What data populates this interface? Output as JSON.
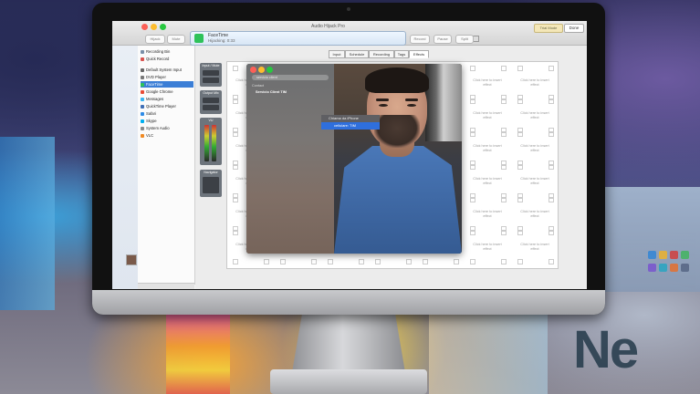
{
  "app": {
    "title": "Audio Hijack Pro",
    "trial_label": "Trial Mode",
    "done_label": "Done",
    "toolbar": {
      "left_btn": "Hijack",
      "left_btn2": "Mute",
      "right_btn": "Record",
      "right_btn2": "Pause",
      "right_btn3": "Split"
    }
  },
  "now_hijacking": {
    "app_name": "FaceTime",
    "status": "Hijacking: 0:33"
  },
  "sidebar": {
    "items": [
      {
        "label": "Recording Bin",
        "color": "#7a8fa8"
      },
      {
        "label": "Quick Record",
        "color": "#d9534f"
      },
      {
        "label": "Default System Input",
        "color": "#666666"
      },
      {
        "label": "DVD Player",
        "color": "#777777"
      },
      {
        "label": "FaceTime",
        "color": "#2ec25a"
      },
      {
        "label": "Google Chrome",
        "color": "#e94b35"
      },
      {
        "label": "Messages",
        "color": "#3ab4f2"
      },
      {
        "label": "QuickTime Player",
        "color": "#3f6fb6"
      },
      {
        "label": "Safari",
        "color": "#2f8be6"
      },
      {
        "label": "Skype",
        "color": "#00aff0"
      },
      {
        "label": "System Audio",
        "color": "#8a8a8a"
      },
      {
        "label": "VLC",
        "color": "#f08a24"
      }
    ],
    "selected_index": 4
  },
  "tabs": [
    "Input",
    "Schedule",
    "Recording",
    "Tags",
    "Effects"
  ],
  "selected_tab": "Effects",
  "effects": {
    "placeholder": "Click here to insert effect",
    "strip_labels": [
      "Input / Mute",
      "Output Mix",
      "VU",
      "Navigator"
    ]
  },
  "facetime": {
    "search_value": "servicio client",
    "section_label": "Contact",
    "contact_name": "Servicio Client TIM",
    "dropdown_item1": "Chiama da iPhone",
    "dropdown_item2": "cellulare: TIM"
  },
  "background": {
    "brand_text": "Ne"
  }
}
